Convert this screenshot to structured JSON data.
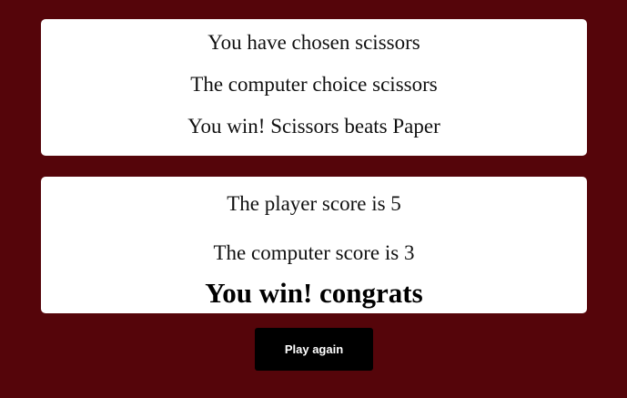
{
  "round": {
    "player_choice_text": "You have chosen scissors",
    "computer_choice_text": "The computer choice scissors",
    "round_result_text": "You win! Scissors beats Paper"
  },
  "score": {
    "player_score_text": "The player score is 5",
    "computer_score_text": "The computer score is 3",
    "final_result_text": "You win! congrats"
  },
  "actions": {
    "play_again_label": "Play again"
  },
  "colors": {
    "background": "#55050a",
    "panel": "#ffffff",
    "button": "#000000",
    "button_text": "#ffffff"
  }
}
